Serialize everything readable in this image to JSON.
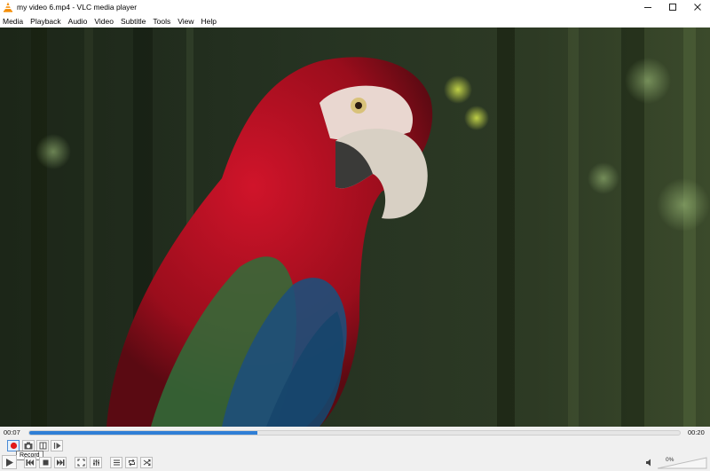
{
  "window": {
    "title": "my video 6.mp4 - VLC media player",
    "app_icon": "vlc-cone-icon",
    "controls": [
      "minimize-icon",
      "maximize-icon",
      "close-icon"
    ]
  },
  "menu": {
    "items": [
      {
        "label": "Media"
      },
      {
        "label": "Playback"
      },
      {
        "label": "Audio"
      },
      {
        "label": "Video"
      },
      {
        "label": "Subtitle"
      },
      {
        "label": "Tools"
      },
      {
        "label": "View"
      },
      {
        "label": "Help"
      }
    ]
  },
  "player": {
    "time_elapsed": "00:07",
    "time_total": "00:20",
    "progress_fraction": 0.35,
    "volume": "0%",
    "volume_fraction": 0.0
  },
  "advanced_controls": {
    "tooltip": "Record",
    "buttons": [
      "record-icon",
      "snapshot-icon",
      "loop-ab-icon",
      "frame-by-frame-icon"
    ]
  },
  "main_controls": {
    "buttons": [
      "play-icon",
      "previous-icon",
      "stop-icon",
      "next-icon",
      "fullscreen-icon",
      "extended-settings-icon",
      "playlist-icon",
      "loop-icon",
      "shuffle-icon",
      "mute-icon"
    ]
  },
  "colors": {
    "seek_fill": "#2f7fd6",
    "record_red": "#e21b1b",
    "vlc_orange": "#f48b00"
  }
}
